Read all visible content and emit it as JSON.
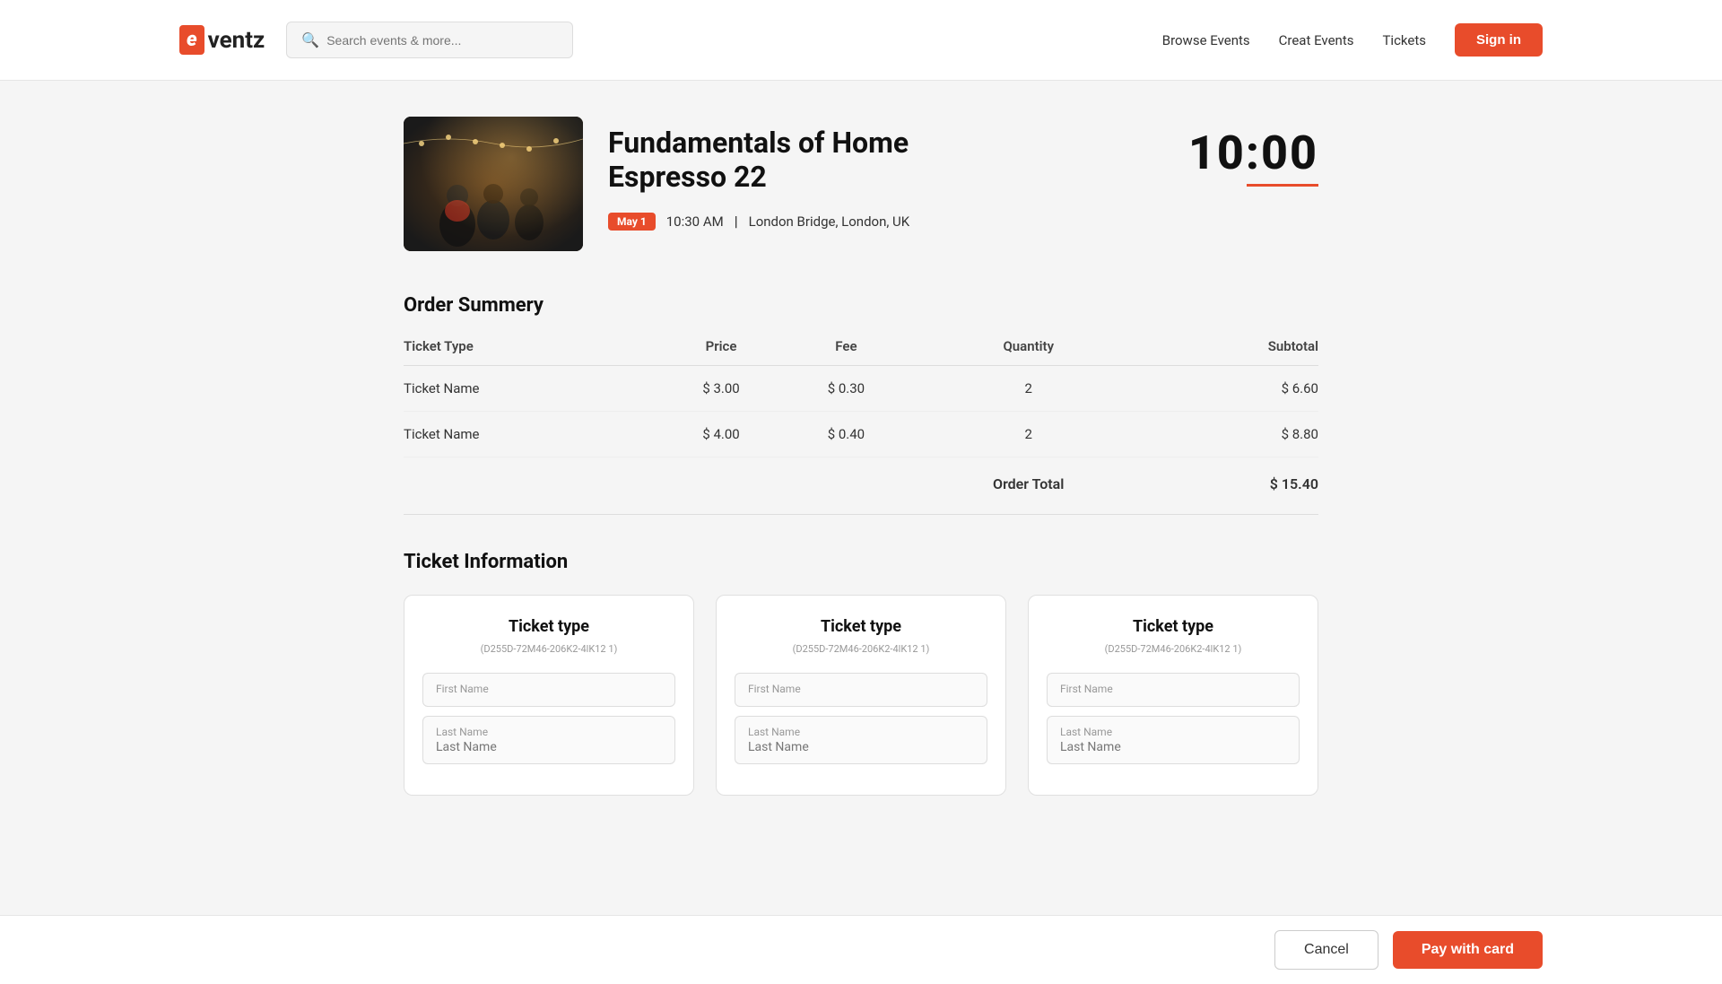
{
  "header": {
    "logo_letter": "e",
    "logo_text": "ventz",
    "search_placeholder": "Search events & more...",
    "nav": {
      "browse": "Browse Events",
      "create": "Creat Events",
      "tickets": "Tickets",
      "signin": "Sign in"
    }
  },
  "event": {
    "title_line1": "Fundamentals of Home",
    "title_line2": "Espresso 22",
    "date_badge": "May 1",
    "time": "10:30 AM",
    "location": "London Bridge, London, UK",
    "timer": "10:00"
  },
  "order_summary": {
    "section_title": "Order Summery",
    "columns": {
      "ticket_type": "Ticket Type",
      "price": "Price",
      "fee": "Fee",
      "quantity": "Quantity",
      "subtotal": "Subtotal"
    },
    "rows": [
      {
        "ticket_name": "Ticket Name",
        "price": "$ 3.00",
        "fee": "$ 0.30",
        "quantity": "2",
        "subtotal": "$ 6.60"
      },
      {
        "ticket_name": "Ticket Name",
        "price": "$ 4.00",
        "fee": "$ 0.40",
        "quantity": "2",
        "subtotal": "$ 8.80"
      }
    ],
    "order_total_label": "Order Total",
    "order_total_value": "$ 15.40"
  },
  "ticket_information": {
    "section_title": "Ticket Information",
    "cards": [
      {
        "type": "Ticket type",
        "id": "(D255D-72M46-206K2-4lK12 1)",
        "last_name_label": "Last Name",
        "last_name_value": "Last Name"
      },
      {
        "type": "Ticket type",
        "id": "(D255D-72M46-206K2-4lK12 1)",
        "last_name_label": "Last Name",
        "last_name_value": "Last Name"
      },
      {
        "type": "Ticket type",
        "id": "(D255D-72M46-206K2-4lK12 1)",
        "last_name_label": "Last Name",
        "last_name_value": "Last Name"
      }
    ]
  },
  "actions": {
    "cancel_label": "Cancel",
    "pay_label": "Pay with card"
  }
}
